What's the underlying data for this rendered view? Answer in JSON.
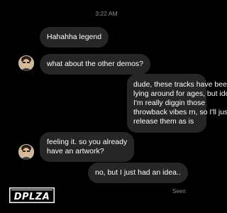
{
  "status": {
    "time": "3:22 AM",
    "seen": "Seen"
  },
  "messages": [
    {
      "sender": "other",
      "lines": [
        "Hahahha legend"
      ]
    },
    {
      "sender": "other",
      "lines": [
        "what about the other demos?"
      ]
    },
    {
      "sender": "me",
      "lines": [
        "dude, these tracks have been",
        "lying around for ages, but idc,",
        "I'm really diggin those",
        "throwback vibes rn, so I'll just",
        "release them as is"
      ]
    },
    {
      "sender": "other",
      "lines": [
        "feeling it. so you already",
        "have an artwork?"
      ]
    },
    {
      "sender": "me",
      "lines": [
        "no, but I just had an idea.."
      ]
    }
  ],
  "brand": {
    "logo_text": "DPLZA"
  },
  "colors": {
    "background": "#000000",
    "bubble": "#262626",
    "muted": "#8e8e8e"
  }
}
